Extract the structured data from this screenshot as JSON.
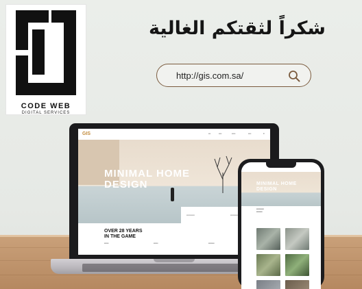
{
  "logo": {
    "title": "CODE WEB",
    "subtitle": "DIGITAL SERVICES"
  },
  "headline": "شكراً لثقتكم الغالية",
  "url_bar": {
    "value": "http://gis.com.sa/",
    "icon": "search-icon"
  },
  "laptop_site": {
    "logo": "GIS",
    "hero_title_line1": "MINIMAL HOME",
    "hero_title_line2": "DESIGN",
    "years_line1": "OVER 28 YEARS",
    "years_line2": "IN THE GAME"
  },
  "phone_site": {
    "hero_title_line1": "MINIMAL HOME",
    "hero_title_line2": "DESIGN"
  },
  "colors": {
    "background": "#e9ece8",
    "accent_brown": "#7a5a3d",
    "desk_wood": "#c39a72",
    "gis_gold": "#c28a3a"
  }
}
